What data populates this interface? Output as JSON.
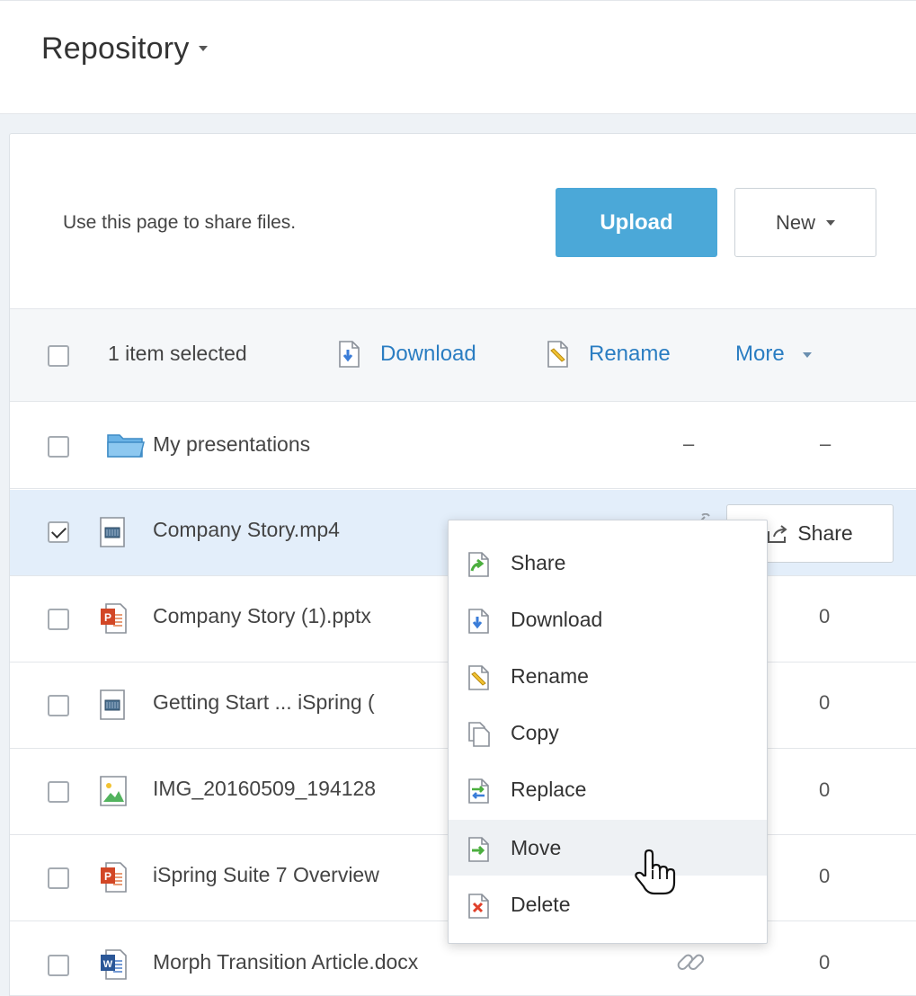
{
  "header": {
    "title": "Repository"
  },
  "intro": {
    "text": "Use this page to share files.",
    "upload_label": "Upload",
    "new_label": "New"
  },
  "toolbar": {
    "selection_text": "1 item selected",
    "download_label": "Download",
    "rename_label": "Rename",
    "more_label": "More"
  },
  "rows": [
    {
      "name": "My presentations",
      "type": "folder",
      "col1": "–",
      "col2": "–",
      "checked": false
    },
    {
      "name": "Company Story.mp4",
      "type": "video",
      "checked": true,
      "share_label": "Share"
    },
    {
      "name": "Company Story (1).pptx",
      "type": "pptx",
      "col2": "0",
      "checked": false
    },
    {
      "name": "Getting Start ... iSpring (",
      "type": "video",
      "col2": "0",
      "checked": false
    },
    {
      "name": "IMG_20160509_194128",
      "type": "image",
      "col2": "0",
      "checked": false
    },
    {
      "name": "iSpring Suite 7 Overview",
      "type": "pptx",
      "col2": "0",
      "checked": false
    },
    {
      "name": "Morph Transition Article.docx",
      "type": "docx",
      "col2": "0",
      "checked": false
    }
  ],
  "context_menu": {
    "items": [
      {
        "label": "Share",
        "icon": "share-icon"
      },
      {
        "label": "Download",
        "icon": "download-icon"
      },
      {
        "label": "Rename",
        "icon": "rename-icon"
      },
      {
        "label": "Copy",
        "icon": "copy-icon"
      },
      {
        "label": "Replace",
        "icon": "replace-icon"
      },
      {
        "label": "Move",
        "icon": "move-icon",
        "hovered": true
      },
      {
        "label": "Delete",
        "icon": "delete-icon"
      }
    ]
  },
  "colors": {
    "accent": "#4ba8d8",
    "link": "#2a7dc2",
    "selected_row": "#e3eefa"
  }
}
